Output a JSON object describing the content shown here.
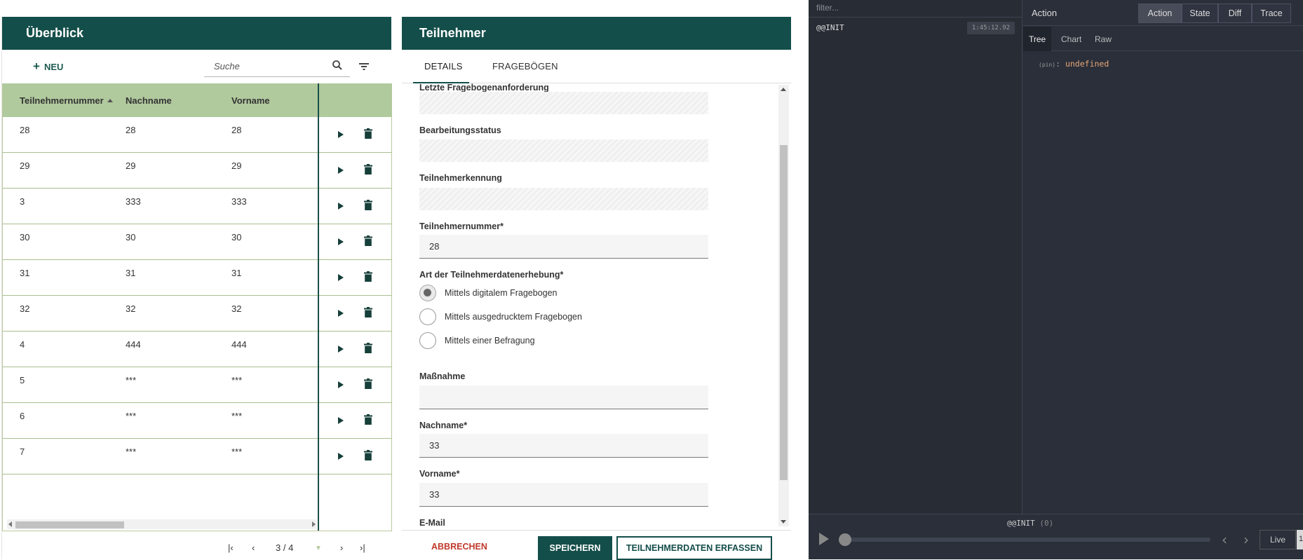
{
  "overview": {
    "title": "Überblick",
    "new_label": "NEU",
    "search_placeholder": "Suche",
    "columns": [
      "Teilnehmernummer",
      "Nachname",
      "Vorname"
    ],
    "rows": [
      [
        "28",
        "28",
        "28"
      ],
      [
        "29",
        "29",
        "29"
      ],
      [
        "3",
        "333",
        "333"
      ],
      [
        "30",
        "30",
        "30"
      ],
      [
        "31",
        "31",
        "31"
      ],
      [
        "32",
        "32",
        "32"
      ],
      [
        "4",
        "444",
        "444"
      ],
      [
        "5",
        "***",
        "***"
      ],
      [
        "6",
        "***",
        "***"
      ],
      [
        "7",
        "***",
        "***"
      ]
    ],
    "pager": {
      "page_text": "3 / 4"
    }
  },
  "participant": {
    "title": "Teilnehmer",
    "tabs": [
      "DETAILS",
      "FRAGEBÖGEN"
    ],
    "fields": {
      "last_request_label": "Letzte Fragebogenanforderung",
      "status_label": "Bearbeitungsstatus",
      "id_label": "Teilnehmerkennung",
      "number_label": "Teilnehmernummer*",
      "number_value": "28",
      "method_label": "Art der Teilnehmerdatenerhebung*",
      "radio_options": [
        "Mittels digitalem Fragebogen",
        "Mittels ausgedrucktem Fragebogen",
        "Mittels einer Befragung"
      ],
      "selected_option": "Mittels digitalem Fragebogen",
      "measure_label": "Maßnahme",
      "measure_value": "",
      "lastname_label": "Nachname*",
      "lastname_value": "33",
      "firstname_label": "Vorname*",
      "firstname_value": "33",
      "email_label": "E-Mail"
    },
    "buttons": {
      "cancel": "ABBRECHEN",
      "save": "SPEICHERN",
      "record": "TEILNEHMERDATEN ERFASSEN"
    }
  },
  "devtools": {
    "filter_placeholder": "filter...",
    "action_name": "@@INIT",
    "action_time": "1:45:12.92",
    "panel_title": "Action",
    "mode_tabs": [
      "Action",
      "State",
      "Diff",
      "Trace"
    ],
    "active_mode": "Action",
    "view_tabs": [
      "Tree",
      "Chart",
      "Raw"
    ],
    "active_view": "Tree",
    "state_key": "(pin)",
    "state_value": "undefined",
    "timeline_label": "@@INIT",
    "timeline_index": "(0)",
    "live_label": "Live",
    "page_indicator": "1"
  }
}
